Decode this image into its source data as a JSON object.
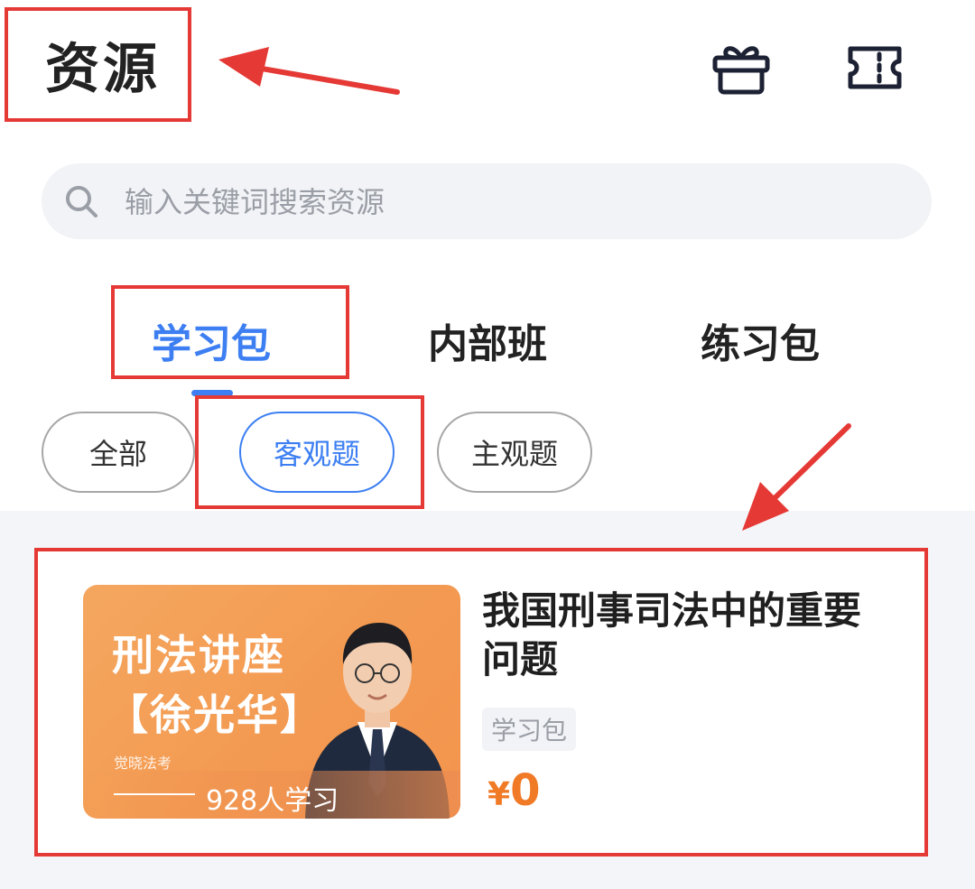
{
  "header": {
    "title": "资源",
    "gift_icon": "gift-icon",
    "ticket_icon": "ticket-icon"
  },
  "search": {
    "placeholder": "输入关键词搜索资源",
    "value": "",
    "icon": "search-icon"
  },
  "tabs": [
    {
      "label": "学习包",
      "active": true
    },
    {
      "label": "内部班",
      "active": false
    },
    {
      "label": "练习包",
      "active": false
    }
  ],
  "filters": [
    {
      "label": "全部",
      "active": false
    },
    {
      "label": "客观题",
      "active": true
    },
    {
      "label": "主观题",
      "active": false
    }
  ],
  "courses": [
    {
      "thumb_title": "刑法讲座",
      "thumb_subtitle": "【徐光华】",
      "thumb_brand": "觉晓法考",
      "learners": "928人学习",
      "title": "我国刑事司法中的重要问题",
      "tag": "学习包",
      "currency": "¥",
      "price": "0"
    }
  ],
  "colors": {
    "accent": "#3d7ff2",
    "price": "#f07a26",
    "annotation": "#e53935",
    "thumb_bg": "#f5a75f"
  }
}
